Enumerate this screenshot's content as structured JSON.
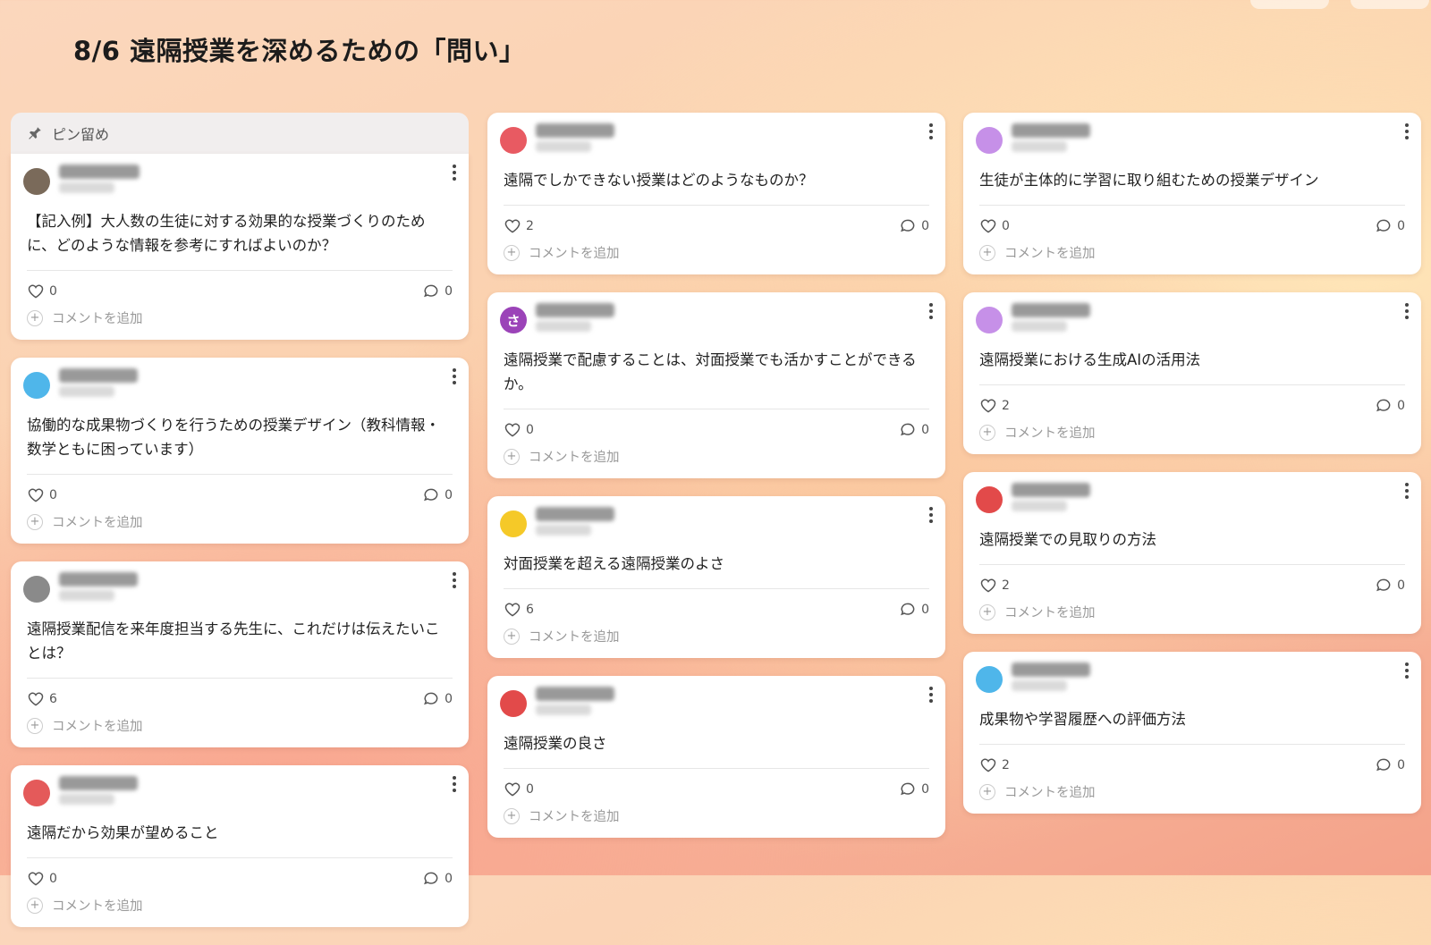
{
  "board": {
    "title": "8/6 遠隔授業を深めるための「問い」"
  },
  "pinned": {
    "label": "ピン留め"
  },
  "add_comment_label": "コメントを追加",
  "columns": [
    {
      "cards": [
        {
          "author": "吉岡英郎 先生",
          "sub": "8月6日",
          "text": "【記入例】大人数の生徒に対する効果的な授業づくりのために、どのような情報を参考にすればよいのか？",
          "likes": "0",
          "comments": "0",
          "avatar_color": "#7a6a5a",
          "avatar_char": ""
        },
        {
          "author": "教員名 先生",
          "sub": "8月6日",
          "text": "協働的な成果物づくりを行うための授業デザイン（教科情報・数学ともに困っています）",
          "likes": "0",
          "comments": "0",
          "avatar_color": "#4fb6ea",
          "avatar_char": ""
        },
        {
          "author": "教員",
          "sub": "8月6日",
          "text": "遠隔授業配信を来年度担当する先生に、これだけは伝えたいことは？",
          "likes": "6",
          "comments": "0",
          "avatar_color": "#8a8a8a",
          "avatar_char": ""
        },
        {
          "author": "教員名 先生",
          "sub": "8月6日",
          "text": "遠隔だから効果が望めること",
          "likes": "0",
          "comments": "0",
          "avatar_color": "#e45a5a",
          "avatar_char": ""
        }
      ]
    },
    {
      "cards": [
        {
          "author": "教員名 先生",
          "sub": "8月6日",
          "text": "遠隔でしかできない授業はどのようなものか？",
          "likes": "2",
          "comments": "0",
          "avatar_color": "#e85a62",
          "avatar_char": ""
        },
        {
          "author": "教員名 先生",
          "sub": "8月6日",
          "text": "遠隔授業で配慮することは、対面授業でも活かすことができるか。",
          "likes": "0",
          "comments": "0",
          "avatar_color": "#9b43b8",
          "avatar_char": "さ"
        },
        {
          "author": "教員名 先生",
          "sub": "8月6日",
          "text": "対面授業を超える遠隔授業のよさ",
          "likes": "6",
          "comments": "0",
          "avatar_color": "#f5c928",
          "avatar_char": ""
        },
        {
          "author": "教員名",
          "sub": "8月6日",
          "text": "遠隔授業の良さ",
          "likes": "0",
          "comments": "0",
          "avatar_color": "#e24a4a",
          "avatar_char": ""
        }
      ]
    },
    {
      "cards": [
        {
          "author": "教員名 先生",
          "sub": "8月6日",
          "text": "生徒が主体的に学習に取り組むための授業デザイン",
          "likes": "0",
          "comments": "0",
          "avatar_color": "#c690e8",
          "avatar_char": ""
        },
        {
          "author": "教員名 先生",
          "sub": "8月6日",
          "text": "遠隔授業における生成AIの活用法",
          "likes": "2",
          "comments": "0",
          "avatar_color": "#c690e8",
          "avatar_char": ""
        },
        {
          "author": "教員名",
          "sub": "8月6日",
          "text": "遠隔授業での見取りの方法",
          "likes": "2",
          "comments": "0",
          "avatar_color": "#e24a4a",
          "avatar_char": ""
        },
        {
          "author": "教員名 先生",
          "sub": "8月6日",
          "text": "成果物や学習履歴への評価方法",
          "likes": "2",
          "comments": "0",
          "avatar_color": "#4fb6ea",
          "avatar_char": ""
        }
      ]
    }
  ],
  "icons": {
    "pin": "pin-icon",
    "like": "heart-icon",
    "comment": "comment-bubble-icon",
    "menu": "more-vertical-icon",
    "add": "plus-icon"
  }
}
